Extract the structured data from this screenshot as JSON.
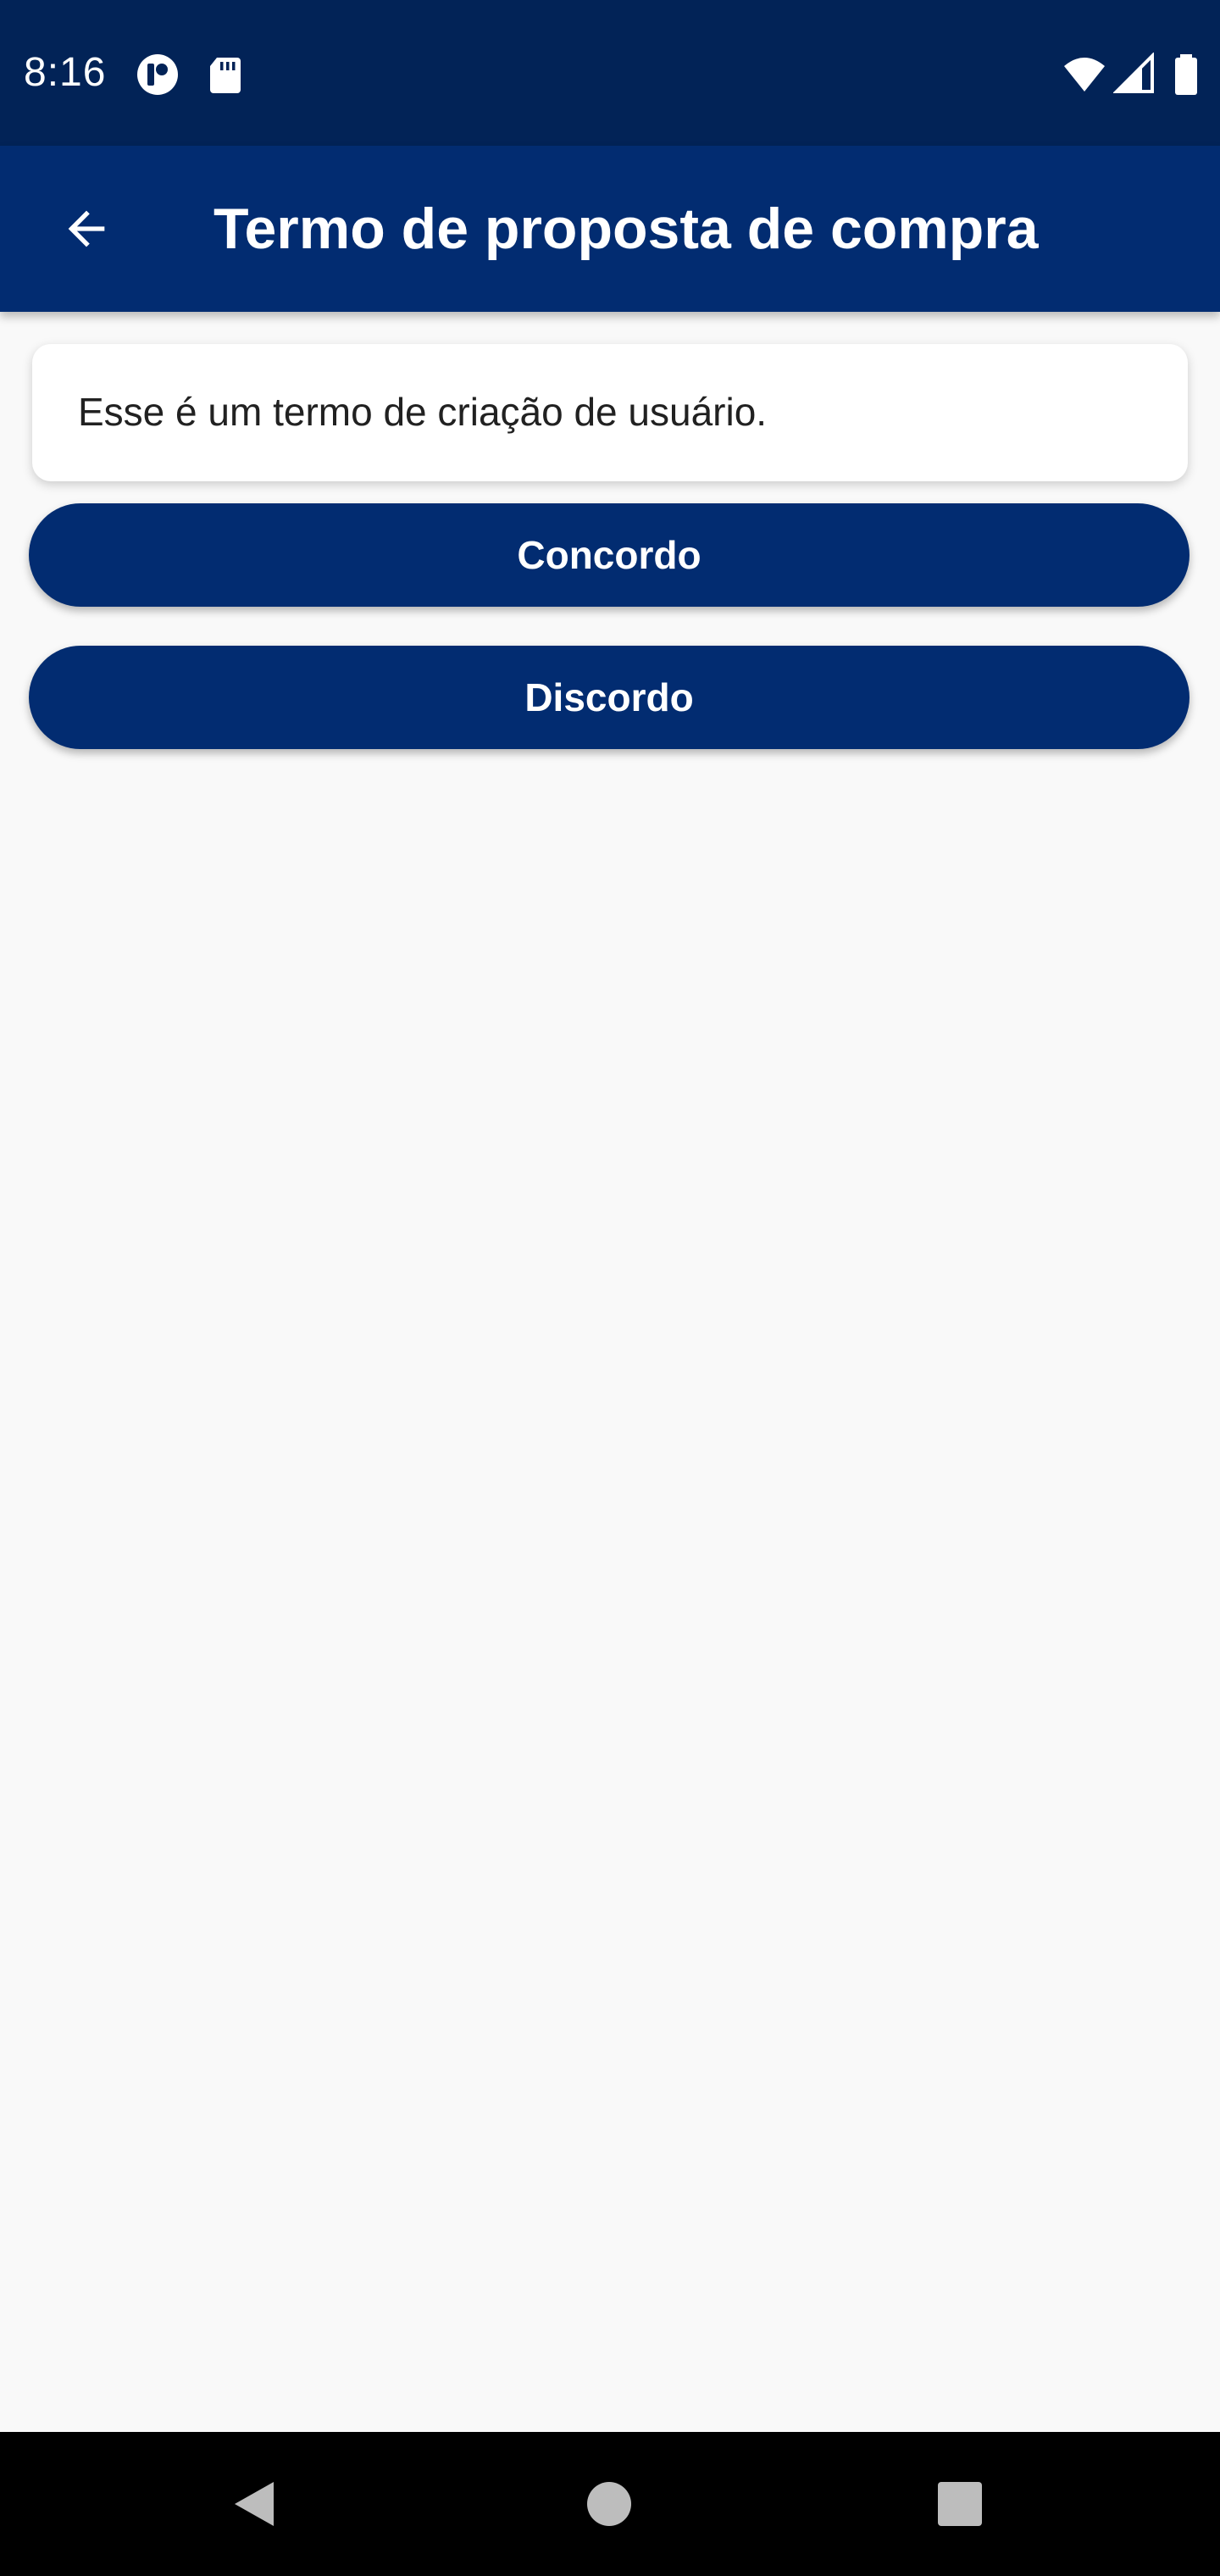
{
  "status_bar": {
    "time": "8:16",
    "icons": [
      "app-notification-icon",
      "sd-card-icon",
      "wifi-icon",
      "cell-signal-icon",
      "battery-icon"
    ]
  },
  "app_bar": {
    "title": "Termo de proposta de compra",
    "back_icon": "arrow-back-icon"
  },
  "term": {
    "text": "Esse é um termo de criação de usuário."
  },
  "actions": {
    "agree_label": "Concordo",
    "disagree_label": "Discordo"
  },
  "nav_bar": {
    "icons": [
      "back-triangle-icon",
      "home-circle-icon",
      "recents-square-icon"
    ]
  },
  "colors": {
    "status_bar": "#022357",
    "primary": "#022c71",
    "background": "#f9f9f9",
    "nav_bar": "#000000"
  }
}
